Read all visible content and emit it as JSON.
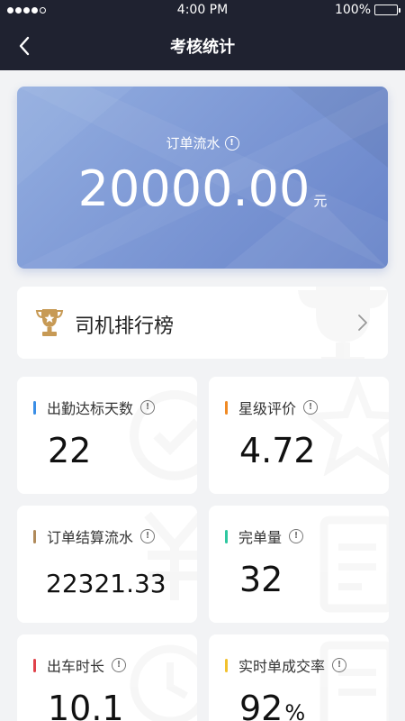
{
  "status_bar": {
    "time": "4:00 PM",
    "battery": "100%",
    "signal_dots": 5,
    "signal_filled": 4
  },
  "nav": {
    "title": "考核统计"
  },
  "hero": {
    "label": "订单流水",
    "amount": "20000.00",
    "unit": "元"
  },
  "ranking": {
    "label": "司机排行榜"
  },
  "stats": [
    {
      "label": "出勤达标天数",
      "value": "22",
      "accent": "#3a8ee6"
    },
    {
      "label": "星级评价",
      "value": "4.72",
      "accent": "#f08a24"
    },
    {
      "label": "订单结算流水",
      "value": "22321.33",
      "accent": "#b08a5a"
    },
    {
      "label": "完单量",
      "value": "32",
      "accent": "#2ec7a0"
    },
    {
      "label": "出车时长",
      "value": "10.1",
      "accent": "#e0414a"
    },
    {
      "label": "实时单成交率",
      "value": "92",
      "suffix": "%",
      "accent": "#f2c12e"
    }
  ],
  "colors": {
    "header_bg": "#1f2230",
    "page_bg": "#f2f3f5",
    "hero_start": "#93aee0",
    "hero_end": "#6783c9",
    "trophy": "#c79a55"
  }
}
